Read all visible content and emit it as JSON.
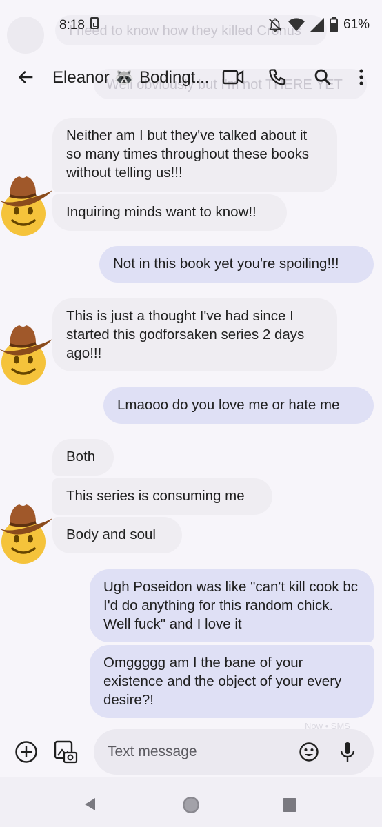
{
  "status_bar": {
    "time": "8:18",
    "battery_percent": "61%"
  },
  "background_ghost": {
    "line1": "I need to know how they killed Cronus",
    "line2": "Well obviously but I'm not THERE YET"
  },
  "header": {
    "contact_name": "Eleanor 🦝 Bodingt..."
  },
  "messages": [
    {
      "side": "in",
      "text": "Neither am I but they've talked about it so many times throughout these books without telling us!!!"
    },
    {
      "side": "in",
      "text": "Inquiring minds want to know!!"
    },
    {
      "side": "out",
      "text": "Not in this book yet you're spoiling!!!"
    },
    {
      "side": "in",
      "text": "This is just a thought I've had since I started this godforsaken series 2 days ago!!!"
    },
    {
      "side": "out",
      "text": "Lmaooo do you love me or hate me"
    },
    {
      "side": "in",
      "text": "Both"
    },
    {
      "side": "in",
      "text": "This series is consuming me"
    },
    {
      "side": "in",
      "text": "Body and soul"
    },
    {
      "side": "out",
      "text": "Ugh Poseidon was like \"can't kill cook bc I'd do anything for this random chick. Well fuck\" and I love it"
    },
    {
      "side": "out",
      "text": "Omggggg am I the bane of your existence and the object of your every desire?!"
    }
  ],
  "delivery_status": "Now • SMS",
  "composer": {
    "placeholder": "Text message"
  },
  "colors": {
    "incoming_bubble": "#efedf2",
    "outgoing_bubble": "#dfe0f5",
    "background": "#f7f5fa"
  }
}
